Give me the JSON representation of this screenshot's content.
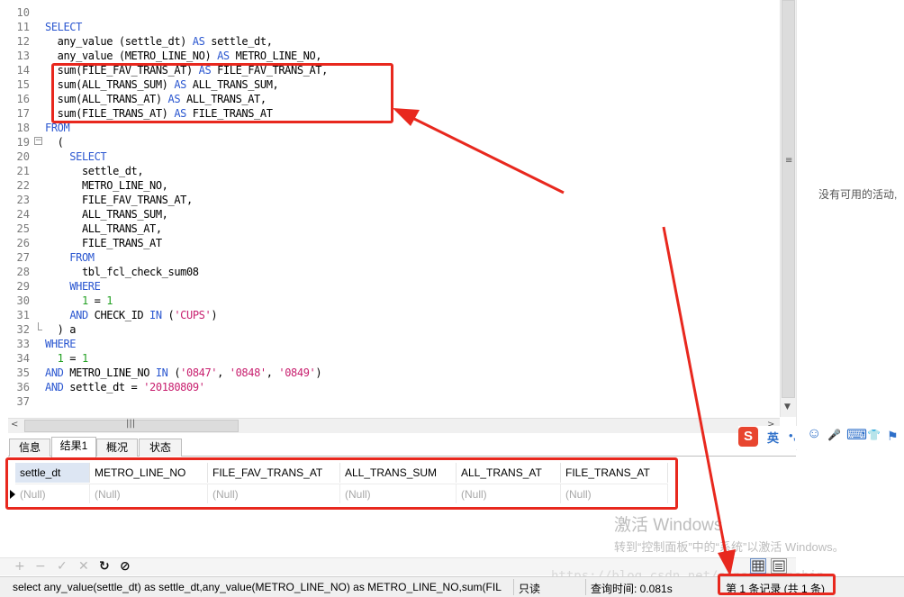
{
  "editor": {
    "lines": [
      {
        "n": "10",
        "segs": []
      },
      {
        "n": "11",
        "segs": [
          {
            "t": "SELECT",
            "c": "kw"
          }
        ]
      },
      {
        "n": "12",
        "segs": [
          {
            "t": "  any_value (settle_dt) ",
            "c": ""
          },
          {
            "t": "AS",
            "c": "kw"
          },
          {
            "t": " settle_dt,",
            "c": ""
          }
        ]
      },
      {
        "n": "13",
        "segs": [
          {
            "t": "  any_value (METRO_LINE_NO) ",
            "c": ""
          },
          {
            "t": "AS",
            "c": "kw"
          },
          {
            "t": " METRO_LINE_NO,",
            "c": ""
          }
        ]
      },
      {
        "n": "14",
        "segs": [
          {
            "t": "  sum(FILE_FAV_TRANS_AT) ",
            "c": ""
          },
          {
            "t": "AS",
            "c": "kw"
          },
          {
            "t": " FILE_FAV_TRANS_AT,",
            "c": ""
          }
        ]
      },
      {
        "n": "15",
        "segs": [
          {
            "t": "  sum(ALL_TRANS_SUM) ",
            "c": ""
          },
          {
            "t": "AS",
            "c": "kw"
          },
          {
            "t": " ALL_TRANS_SUM,",
            "c": ""
          }
        ]
      },
      {
        "n": "16",
        "segs": [
          {
            "t": "  sum(ALL_TRANS_AT) ",
            "c": ""
          },
          {
            "t": "AS",
            "c": "kw"
          },
          {
            "t": " ALL_TRANS_AT,",
            "c": ""
          }
        ]
      },
      {
        "n": "17",
        "segs": [
          {
            "t": "  sum(FILE_TRANS_AT) ",
            "c": ""
          },
          {
            "t": "AS",
            "c": "kw"
          },
          {
            "t": " FILE_TRANS_AT",
            "c": ""
          }
        ]
      },
      {
        "n": "18",
        "segs": [
          {
            "t": "FROM",
            "c": "kw"
          }
        ]
      },
      {
        "n": "19",
        "fold": "open",
        "segs": [
          {
            "t": "  (",
            "c": ""
          }
        ]
      },
      {
        "n": "20",
        "segs": [
          {
            "t": "    SELECT",
            "c": "kw"
          }
        ]
      },
      {
        "n": "21",
        "segs": [
          {
            "t": "      settle_dt,",
            "c": ""
          }
        ]
      },
      {
        "n": "22",
        "segs": [
          {
            "t": "      METRO_LINE_NO,",
            "c": ""
          }
        ]
      },
      {
        "n": "23",
        "segs": [
          {
            "t": "      FILE_FAV_TRANS_AT,",
            "c": ""
          }
        ]
      },
      {
        "n": "24",
        "segs": [
          {
            "t": "      ALL_TRANS_SUM,",
            "c": ""
          }
        ]
      },
      {
        "n": "25",
        "segs": [
          {
            "t": "      ALL_TRANS_AT,",
            "c": ""
          }
        ]
      },
      {
        "n": "26",
        "segs": [
          {
            "t": "      FILE_TRANS_AT",
            "c": ""
          }
        ]
      },
      {
        "n": "27",
        "segs": [
          {
            "t": "    FROM",
            "c": "kw"
          }
        ]
      },
      {
        "n": "28",
        "segs": [
          {
            "t": "      tbl_fcl_check_sum08",
            "c": ""
          }
        ]
      },
      {
        "n": "29",
        "segs": [
          {
            "t": "    WHERE",
            "c": "kw"
          }
        ]
      },
      {
        "n": "30",
        "segs": [
          {
            "t": "      ",
            "c": ""
          },
          {
            "t": "1",
            "c": "num"
          },
          {
            "t": " = ",
            "c": ""
          },
          {
            "t": "1",
            "c": "num"
          }
        ]
      },
      {
        "n": "31",
        "segs": [
          {
            "t": "    ",
            "c": ""
          },
          {
            "t": "AND",
            "c": "kw"
          },
          {
            "t": " CHECK_ID ",
            "c": ""
          },
          {
            "t": "IN",
            "c": "kw"
          },
          {
            "t": " (",
            "c": ""
          },
          {
            "t": "'CUPS'",
            "c": "str"
          },
          {
            "t": ")",
            "c": ""
          }
        ]
      },
      {
        "n": "32",
        "fold": "end",
        "segs": [
          {
            "t": "  ) a",
            "c": ""
          }
        ]
      },
      {
        "n": "33",
        "segs": [
          {
            "t": "WHERE",
            "c": "kw"
          }
        ]
      },
      {
        "n": "34",
        "segs": [
          {
            "t": "  ",
            "c": ""
          },
          {
            "t": "1",
            "c": "num"
          },
          {
            "t": " = ",
            "c": ""
          },
          {
            "t": "1",
            "c": "num"
          }
        ]
      },
      {
        "n": "35",
        "segs": [
          {
            "t": "AND",
            "c": "kw"
          },
          {
            "t": " METRO_LINE_NO ",
            "c": ""
          },
          {
            "t": "IN",
            "c": "kw"
          },
          {
            "t": " (",
            "c": ""
          },
          {
            "t": "'0847'",
            "c": "str"
          },
          {
            "t": ", ",
            "c": ""
          },
          {
            "t": "'0848'",
            "c": "str"
          },
          {
            "t": ", ",
            "c": ""
          },
          {
            "t": "'0849'",
            "c": "str"
          },
          {
            "t": ")",
            "c": ""
          }
        ]
      },
      {
        "n": "36",
        "segs": [
          {
            "t": "AND",
            "c": "kw"
          },
          {
            "t": " settle_dt = ",
            "c": ""
          },
          {
            "t": "'20180809'",
            "c": "str"
          }
        ]
      },
      {
        "n": "37",
        "segs": []
      }
    ]
  },
  "right_panel": {
    "no_activity": "没有可用的活动,"
  },
  "ime": {
    "logo": "S",
    "lang": "英",
    "punct": "•,",
    "emoji": "☺",
    "mic": "🎤",
    "keyboard": "⌨",
    "skin": "👕",
    "tshirt": "⚑"
  },
  "tabs": [
    {
      "label": "信息",
      "active": false
    },
    {
      "label": "结果1",
      "active": true
    },
    {
      "label": "概况",
      "active": false
    },
    {
      "label": "状态",
      "active": false
    }
  ],
  "results": {
    "columns": [
      "settle_dt",
      "METRO_LINE_NO",
      "FILE_FAV_TRANS_AT",
      "ALL_TRANS_SUM",
      "ALL_TRANS_AT",
      "FILE_TRANS_AT"
    ],
    "rows": [
      [
        "(Null)",
        "(Null)",
        "(Null)",
        "(Null)",
        "(Null)",
        "(Null)"
      ]
    ]
  },
  "watermark": {
    "line1": "激活 Windows",
    "line2": "转到“控制面板”中的“系统”以激活 Windows。",
    "blog": "https://blog.csdn.net/sinat_shinshin"
  },
  "record_toolbar": {
    "add": "+",
    "remove": "−",
    "apply": "✓",
    "discard": "✕",
    "refresh": "↻",
    "stop": "⊘"
  },
  "status": {
    "sql": "select any_value(settle_dt) as settle_dt,any_value(METRO_LINE_NO) as METRO_LINE_NO,sum(FIL",
    "readonly": "只读",
    "query_time": "查询时间: 0.081s",
    "records": "第 1 条记录 (共 1 条)"
  }
}
